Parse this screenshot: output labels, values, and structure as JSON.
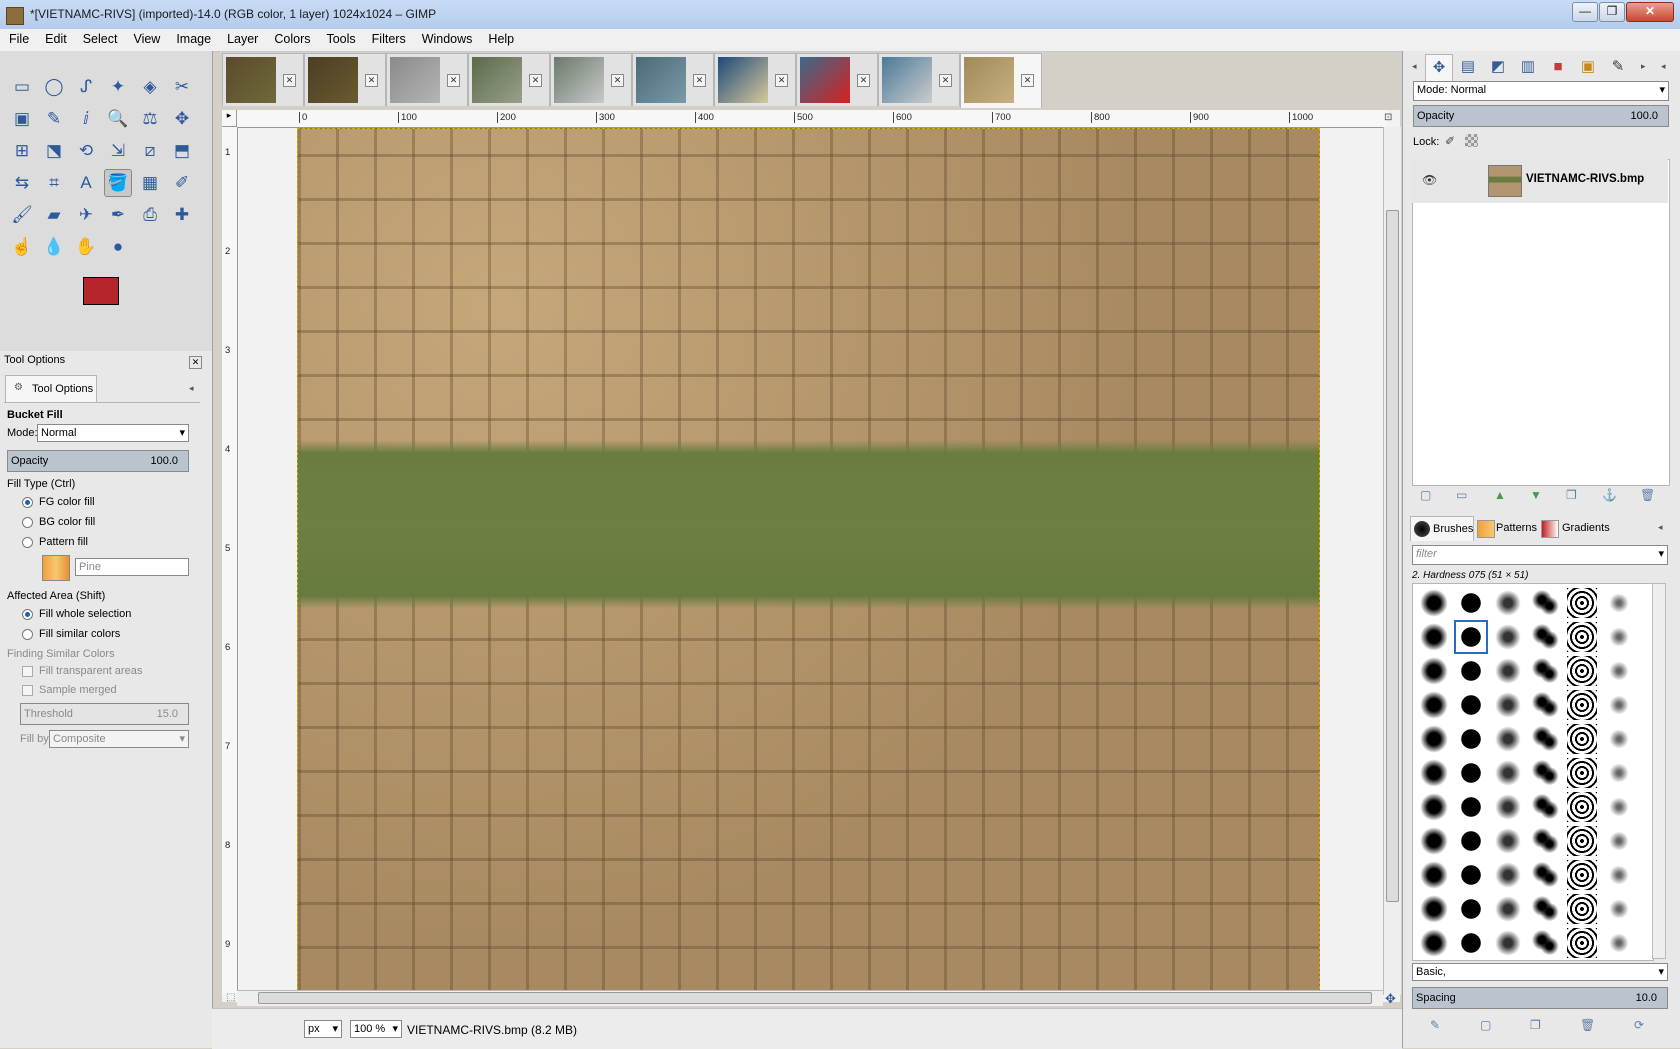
{
  "window": {
    "title": "*[VIETNAMC-RIVS] (imported)-14.0 (RGB color, 1 layer) 1024x1024 – GIMP",
    "controls": [
      "—",
      "❐",
      "✕"
    ]
  },
  "menu": [
    "File",
    "Edit",
    "Select",
    "View",
    "Image",
    "Layer",
    "Colors",
    "Tools",
    "Filters",
    "Windows",
    "Help"
  ],
  "toolbox": {
    "tools": [
      "rect-select",
      "ellipse-select",
      "free-select",
      "fuzzy-select",
      "color-select",
      "scissors",
      "foreground-select",
      "paths",
      "color-picker",
      "zoom",
      "measure",
      "move",
      "align",
      "free-transform",
      "rotate",
      "scale",
      "shear",
      "perspective",
      "flip",
      "cage",
      "text",
      "bucket-fill",
      "blend",
      "pencil",
      "paintbrush",
      "eraser",
      "airbrush",
      "ink",
      "clone",
      "heal",
      "smudge",
      "blur",
      "dodge",
      "ink-blot"
    ],
    "tool_glyphs": [
      "▭",
      "◯",
      "ᔑ",
      "✦",
      "◈",
      "✂",
      "▣",
      "✎",
      "ⅈ",
      "🔍",
      "⚖",
      "✥",
      "⊞",
      "⬔",
      "⟲",
      "⇲",
      "⧄",
      "⬒",
      "⇆",
      "⌗",
      "A",
      "🪣",
      "▦",
      "✐",
      "🖌",
      "▰",
      "✈",
      "✒",
      "⎙",
      "✚",
      "☝",
      "💧",
      "✋",
      "●"
    ],
    "selected_tool_index": 21,
    "fg_color": "#b3252a",
    "bg_color": "#ffffff"
  },
  "tool_options": {
    "panel_title": "Tool Options",
    "tab_label": "Tool Options",
    "tool_name": "Bucket Fill",
    "mode_label": "Mode:",
    "mode_value": "Normal",
    "opacity_label": "Opacity",
    "opacity_value": "100.0",
    "fill_type_label": "Fill Type  (Ctrl)",
    "fill_types": [
      "FG color fill",
      "BG color fill",
      "Pattern fill"
    ],
    "fill_type_selected": 0,
    "pattern_name": "Pine",
    "affected_area_label": "Affected Area  (Shift)",
    "affected_areas": [
      "Fill whole selection",
      "Fill similar colors"
    ],
    "affected_area_selected": 0,
    "finding_label": "Finding Similar Colors",
    "fill_transparent_label": "Fill transparent areas",
    "sample_merged_label": "Sample merged",
    "threshold_label": "Threshold",
    "threshold_value": "15.0",
    "fill_by_label": "Fill by:",
    "fill_by_value": "Composite"
  },
  "image_tabs": [
    {
      "colors": [
        "#5b4a2c",
        "#6f6a3a"
      ]
    },
    {
      "colors": [
        "#4a3f22",
        "#6b5a32"
      ]
    },
    {
      "colors": [
        "#8a8a8a",
        "#b5b5b5"
      ]
    },
    {
      "colors": [
        "#5a6a4a",
        "#9aa08a"
      ]
    },
    {
      "colors": [
        "#6a7a6a",
        "#c9c9c9"
      ]
    },
    {
      "colors": [
        "#4a6a7a",
        "#7a9aaa"
      ]
    },
    {
      "colors": [
        "#1d4a7a",
        "#d8c89a"
      ]
    },
    {
      "colors": [
        "#3a6a8a",
        "#d82020"
      ]
    },
    {
      "colors": [
        "#4a7a9a",
        "#cccccc"
      ]
    },
    {
      "colors": [
        "#a08a5a",
        "#c8b080"
      ]
    }
  ],
  "active_tab": 9,
  "ruler": {
    "top_labels": [
      "0",
      "100",
      "200",
      "300",
      "400",
      "500",
      "600",
      "700",
      "800",
      "900",
      "1000"
    ],
    "left_labels": [
      "1",
      "2",
      "3",
      "4",
      "5",
      "6",
      "7",
      "8",
      "9"
    ]
  },
  "status": {
    "unit": "px",
    "zoom": "100 %",
    "file_info": "VIETNAMC-RIVS.bmp (8.2 MB)"
  },
  "layers": {
    "mode_label": "Mode: Normal",
    "opacity_label": "Opacity",
    "opacity_value": "100.0",
    "lock_label": "Lock:",
    "layer_name": "VIETNAMC-RIVS.bmp"
  },
  "brushes": {
    "tabs": [
      "Brushes",
      "Patterns",
      "Gradients"
    ],
    "filter_placeholder": "filter",
    "selected_brush": "2. Hardness 075 (51 × 51)",
    "tag_value": "Basic,",
    "spacing_label": "Spacing",
    "spacing_value": "10.0"
  }
}
